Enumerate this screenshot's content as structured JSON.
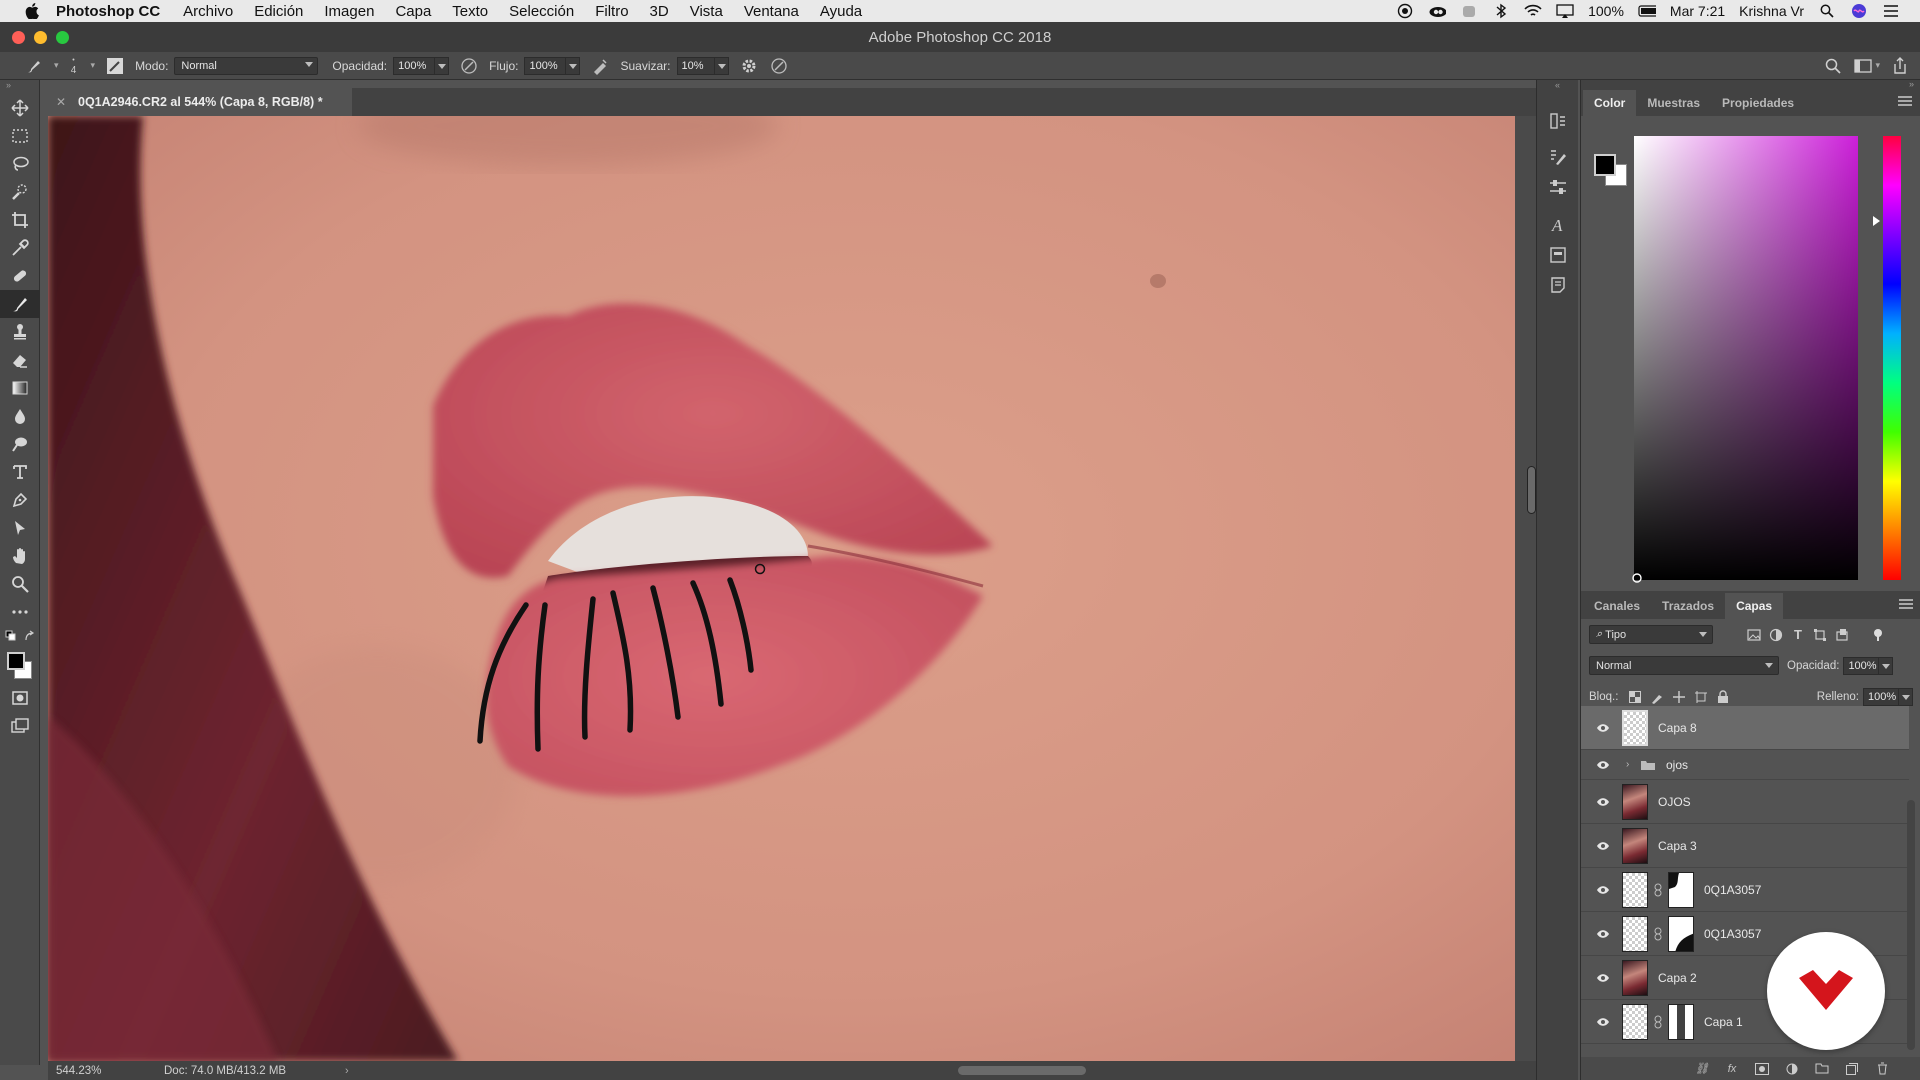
{
  "menubar": {
    "items": [
      "Photoshop CC",
      "Archivo",
      "Edición",
      "Imagen",
      "Capa",
      "Texto",
      "Selección",
      "Filtro",
      "3D",
      "Vista",
      "Ventana",
      "Ayuda"
    ],
    "battery": "100%",
    "clock": "Mar 7:21",
    "user": "Krishna Vr"
  },
  "window": {
    "title": "Adobe Photoshop CC 2018"
  },
  "options": {
    "brush_size": "4",
    "mode_label": "Modo:",
    "mode_value": "Normal",
    "opacity_label": "Opacidad:",
    "opacity_value": "100%",
    "flow_label": "Flujo:",
    "flow_value": "100%",
    "smooth_label": "Suavizar:",
    "smooth_value": "10%"
  },
  "document": {
    "tab_label": "0Q1A2946.CR2 al 544% (Capa 8, RGB/8) *"
  },
  "statusbar": {
    "zoom": "544.23%",
    "doc_info": "Doc: 74.0 MB/413.2 MB"
  },
  "color_panel": {
    "tabs": [
      "Color",
      "Muestras",
      "Propiedades"
    ],
    "active_tab": "Color",
    "foreground": "#000000",
    "background": "#ffffff",
    "hue_color": "#cc1fd9"
  },
  "layers_panel": {
    "tabs": [
      "Canales",
      "Trazados",
      "Capas"
    ],
    "active_tab": "Capas",
    "filter_value": "Tipo",
    "blend_mode": "Normal",
    "opacity_label": "Opacidad:",
    "opacity_value": "100%",
    "lock_label": "Bloq.:",
    "fill_label": "Relleno:",
    "fill_value": "100%",
    "layers": [
      {
        "name": "Capa 8",
        "kind": "layer",
        "selected": true,
        "thumb": "transparent",
        "mask": false
      },
      {
        "name": "ojos",
        "kind": "group",
        "selected": false
      },
      {
        "name": "OJOS",
        "kind": "layer",
        "selected": false,
        "thumb": "portrait",
        "mask": false
      },
      {
        "name": "Capa 3",
        "kind": "layer",
        "selected": false,
        "thumb": "portrait",
        "mask": false
      },
      {
        "name": "0Q1A3057",
        "kind": "layer",
        "selected": false,
        "thumb": "transparent",
        "mask": true
      },
      {
        "name": "0Q1A3057",
        "kind": "layer",
        "selected": false,
        "thumb": "transparent",
        "mask": true
      },
      {
        "name": "Capa 2",
        "kind": "layer",
        "selected": false,
        "thumb": "portrait",
        "mask": false
      },
      {
        "name": "Capa 1",
        "kind": "layer",
        "selected": false,
        "thumb": "transparent",
        "mask": true
      }
    ]
  },
  "tools": [
    "move-tool",
    "marquee-tool",
    "lasso-tool",
    "quick-select-tool",
    "crop-tool",
    "eyedropper-tool",
    "healing-tool",
    "brush-tool",
    "stamp-tool",
    "eraser-tool",
    "gradient-tool",
    "blur-tool",
    "dodge-tool",
    "type-tool",
    "pen-tool",
    "path-select-tool",
    "hand-tool",
    "zoom-tool",
    "more-tools"
  ],
  "active_tool": "brush-tool"
}
